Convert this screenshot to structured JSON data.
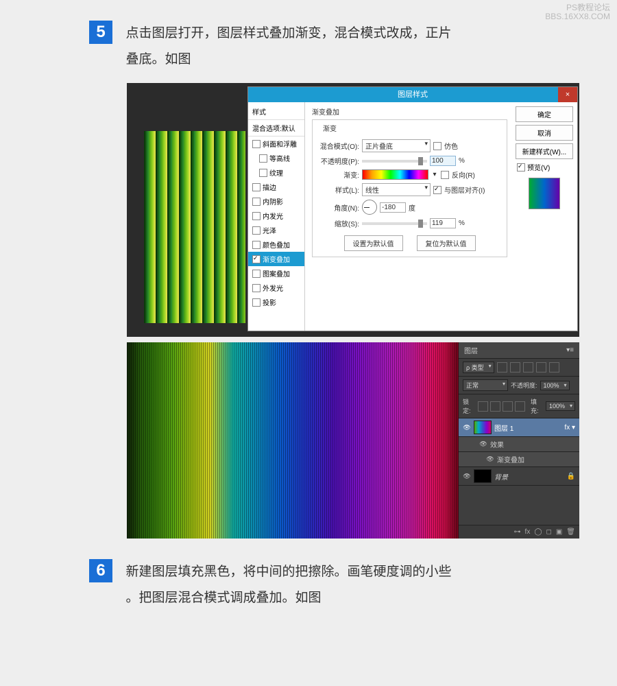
{
  "watermark": {
    "line1": "PS教程论坛",
    "line2": "BBS.16XX8.COM"
  },
  "step5": {
    "num": "5",
    "text_line1": "点击图层打开，图层样式叠加渐变，混合模式改成，正片",
    "text_line2": "叠底。如图"
  },
  "step6": {
    "num": "6",
    "text_line1": "新建图层填充黑色，将中间的把擦除。画笔硬度调的小些",
    "text_line2": "。把图层混合模式调成叠加。如图"
  },
  "layer_style": {
    "title": "图层样式",
    "left": {
      "header": "样式",
      "blend_defaults": "混合选项:默认",
      "items": [
        {
          "label": "斜面和浮雕",
          "checked": false
        },
        {
          "label": "等高线",
          "checked": false,
          "indent": true
        },
        {
          "label": "纹理",
          "checked": false,
          "indent": true
        },
        {
          "label": "描边",
          "checked": false
        },
        {
          "label": "内阴影",
          "checked": false
        },
        {
          "label": "内发光",
          "checked": false
        },
        {
          "label": "光泽",
          "checked": false
        },
        {
          "label": "颜色叠加",
          "checked": false
        },
        {
          "label": "渐变叠加",
          "checked": true,
          "selected": true
        },
        {
          "label": "图案叠加",
          "checked": false
        },
        {
          "label": "外发光",
          "checked": false
        },
        {
          "label": "投影",
          "checked": false
        }
      ]
    },
    "center": {
      "section_title": "渐变叠加",
      "subsection": "渐变",
      "blend_mode_label": "混合模式(O):",
      "blend_mode_value": "正片叠底",
      "dither_label": "仿色",
      "opacity_label": "不透明度(P):",
      "opacity_value": "100",
      "opacity_unit": "%",
      "gradient_label": "渐变:",
      "reverse_label": "反向(R)",
      "style_label": "样式(L):",
      "style_value": "线性",
      "align_label": "与图层对齐(I)",
      "angle_label": "角度(N):",
      "angle_value": "-180",
      "angle_unit": "度",
      "scale_label": "缩放(S):",
      "scale_value": "119",
      "scale_unit": "%",
      "btn_default": "设置为默认值",
      "btn_reset": "复位为默认值"
    },
    "right": {
      "ok": "确定",
      "cancel": "取消",
      "new_style": "新建样式(W)...",
      "preview": "预览(V)"
    }
  },
  "layers_panel": {
    "tab": "图层",
    "kind_label": "ρ 类型",
    "blend_mode": "正常",
    "opacity_label": "不透明度:",
    "opacity_value": "100%",
    "lock_label": "锁定:",
    "fill_label": "填充:",
    "fill_value": "100%",
    "layers": [
      {
        "name": "图层 1",
        "selected": true,
        "fx": true,
        "effects_label": "效果",
        "effect_item": "渐变叠加"
      },
      {
        "name": "背景",
        "locked": true
      }
    ],
    "footerIcons": [
      "fx",
      "◯",
      "◻",
      "▣",
      "🗑"
    ]
  }
}
